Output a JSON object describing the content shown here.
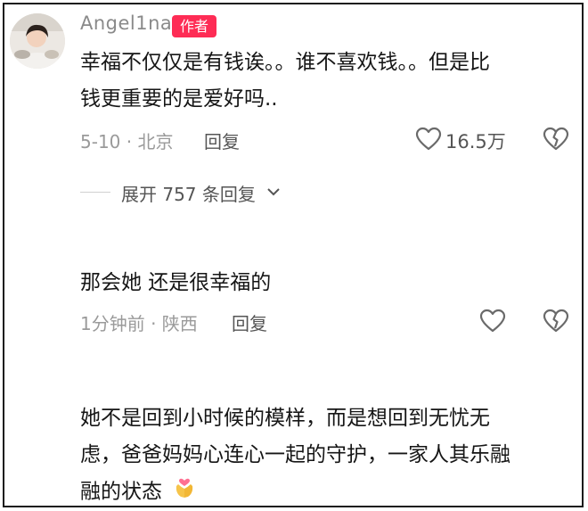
{
  "comment1": {
    "username": "Angel1na",
    "badge": "作者",
    "text_line1": "幸福不仅仅是有钱诶。。谁不喜欢钱。。但是比",
    "text_line2": "钱更重要的是爱好吗..",
    "meta": "5-10 · 北京",
    "reply": "回复",
    "likes": "16.5万",
    "expand": "展开 757 条回复"
  },
  "comment2": {
    "text": "那会她 还是很幸福的",
    "meta": "1分钟前 · 陕西",
    "reply": "回复"
  },
  "comment3": {
    "text_line1": "她不是回到小时候的模样，而是想回到无忧无",
    "text_line2": "虑，爸爸妈妈心连心一起的守护，一家人其乐融",
    "text_line3": "融的状态",
    "emoji": "hands-heart-emoji"
  },
  "icons": {
    "like": "heart-outline-icon",
    "dislike": "broken-heart-icon",
    "expand": "chevron-down-icon"
  }
}
